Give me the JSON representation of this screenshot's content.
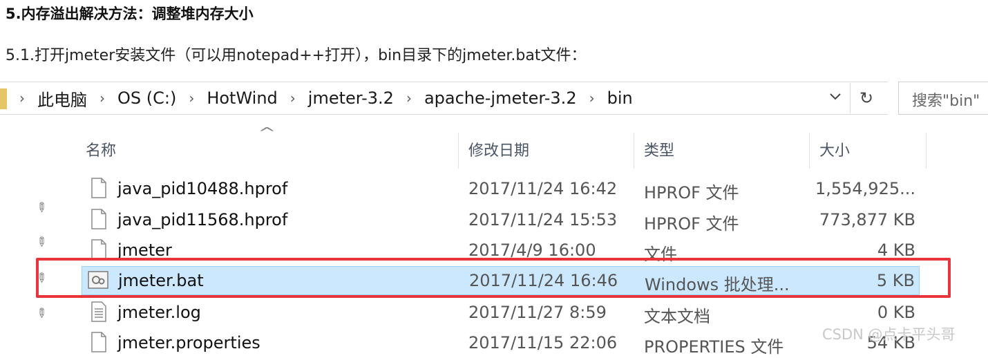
{
  "heading": "5.内存溢出解决方法：调整堆内存大小",
  "subtext": "5.1.打开jmeter安装文件（可以用notepad++打开），bin目录下的jmeter.bat文件：",
  "address_bar": {
    "crumbs": [
      "此电脑",
      "OS (C:)",
      "HotWind",
      "jmeter-3.2",
      "apache-jmeter-3.2",
      "bin"
    ],
    "separator": "›",
    "search_placeholder": "搜索\"bin\""
  },
  "columns": {
    "name": "名称",
    "date": "修改日期",
    "type": "类型",
    "size": "大小"
  },
  "files": [
    {
      "name": "java_pid10488.hprof",
      "date": "2017/11/24 16:42",
      "type": "HPROF 文件",
      "size": "1,554,925...",
      "icon": "file-icon"
    },
    {
      "name": "java_pid11568.hprof",
      "date": "2017/11/24 15:53",
      "type": "HPROF 文件",
      "size": "773,877 KB",
      "icon": "file-icon"
    },
    {
      "name": "jmeter",
      "date": "2017/4/9 16:00",
      "type": "文件",
      "size": "4 KB",
      "icon": "file-icon"
    },
    {
      "name": "jmeter.bat",
      "date": "2017/11/24 16:46",
      "type": "Windows 批处理...",
      "size": "5 KB",
      "icon": "batch-file-icon",
      "selected": true
    },
    {
      "name": "jmeter.log",
      "date": "2017/11/27 8:59",
      "type": "文本文档",
      "size": "0 KB",
      "icon": "text-file-icon"
    },
    {
      "name": "jmeter.properties",
      "date": "2017/11/15 22:06",
      "type": "PROPERTIES 文件",
      "size": "54 KB",
      "icon": "file-icon"
    }
  ],
  "watermark": "CSDN @点卡平头哥",
  "colors": {
    "selection_bg": "#cce8ff",
    "selection_border": "#99d1ff",
    "highlight_red": "#e8343a"
  }
}
